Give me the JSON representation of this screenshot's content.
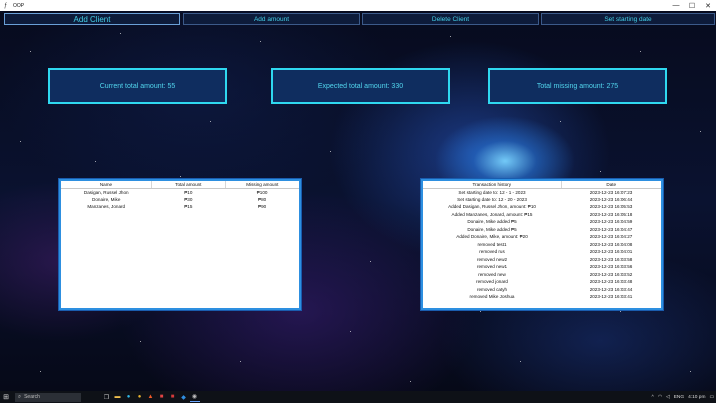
{
  "window": {
    "title": "OOP"
  },
  "toolbar": {
    "add_client": "Add Client",
    "add_amount": "Add amount",
    "delete_client": "Delete Client",
    "set_starting_date": "Set starting date"
  },
  "stats": {
    "current_total": "Current total amount: 55",
    "expected_total": "Expected total amount: 330",
    "total_missing": "Total missing amount: 275"
  },
  "clients_table": {
    "headers": [
      "Name",
      "Total amount",
      "Missing amount"
    ],
    "rows": [
      [
        "Dasigan, Russel Jhon",
        "₱10",
        "₱100"
      ],
      [
        "Donaire, Mike",
        "₱30",
        "₱80"
      ],
      [
        "Manzanes, Jonard",
        "₱15",
        "₱90"
      ]
    ]
  },
  "history_table": {
    "headers": [
      "Transaction history",
      "Date"
    ],
    "rows": [
      [
        "Set starting date to: 12 - 1 - 2023",
        "2023-12-23 16:07:23"
      ],
      [
        "Set starting date to: 12 - 20 - 2023",
        "2023-12-23 16:06:44"
      ],
      [
        "Added Dasigan, Russel Jhon, amount: ₱10",
        "2023-12-23 16:05:53"
      ],
      [
        "Added Manzanes, Jonard, amount: ₱15",
        "2023-12-23 16:05:18"
      ],
      [
        "Donaire, Mike added ₱5",
        "2023-12-23 16:04:59"
      ],
      [
        "Donaire, Mike added ₱5",
        "2023-12-23 16:04:47"
      ],
      [
        "Added Donaire, Mike, amount: ₱20",
        "2023-12-23 16:04:27"
      ],
      [
        "removed test1",
        "2023-12-23 16:04:08"
      ],
      [
        "removed rus",
        "2023-12-23 16:04:01"
      ],
      [
        "removed new2",
        "2023-12-23 16:03:58"
      ],
      [
        "removed new1",
        "2023-12-23 16:03:56"
      ],
      [
        "removed new",
        "2023-12-23 16:03:52"
      ],
      [
        "removed jonard",
        "2023-12-23 16:03:48"
      ],
      [
        "removed catyh",
        "2023-12-23 16:03:44"
      ],
      [
        "removed Mike Joshua",
        "2023-12-23 16:03:41"
      ]
    ]
  },
  "taskbar": {
    "search_placeholder": "Search",
    "language": "ENG",
    "time": "4:10 pm",
    "icons": [
      "start-icon",
      "search-icon",
      "task-view-icon",
      "file-explorer-icon",
      "edge-icon",
      "chrome-icon",
      "brave-icon",
      "app-icon",
      "vscode-icon",
      "python-app-icon"
    ]
  },
  "colors": {
    "accent": "#2fd8f0",
    "button_text": "#45d0e8",
    "panel_border": "#2d8fe0",
    "stat_bg": "#0f2d5f"
  }
}
